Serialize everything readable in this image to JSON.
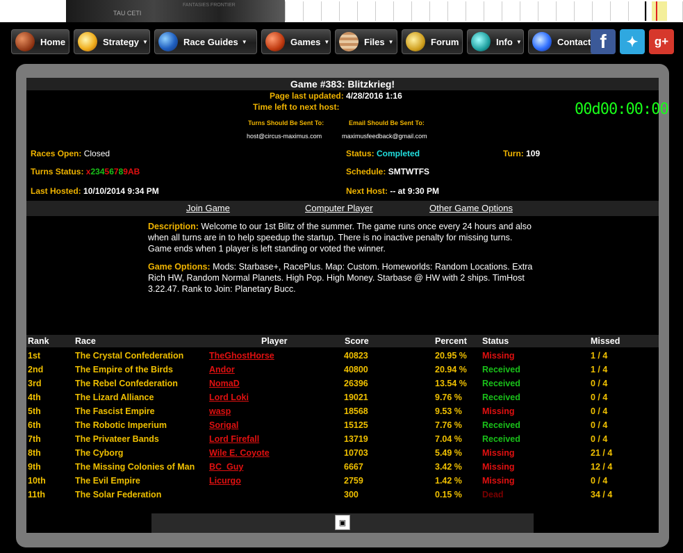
{
  "banner": {
    "site_name": "TAU CETI",
    "tagline": "FANTASIES FRONTIER"
  },
  "nav": {
    "items": [
      {
        "label": "Home",
        "icon": "mars-planet-icon",
        "has_dropdown": false
      },
      {
        "label": "Strategy",
        "icon": "sun-planet-icon",
        "has_dropdown": true
      },
      {
        "label": "Race Guides",
        "icon": "earth-planet-icon",
        "has_dropdown": true
      },
      {
        "label": "Games",
        "icon": "red-planet-icon",
        "has_dropdown": true
      },
      {
        "label": "Files",
        "icon": "jupiter-planet-icon",
        "has_dropdown": true
      },
      {
        "label": "Forum",
        "icon": "saturn-planet-icon",
        "has_dropdown": false
      },
      {
        "label": "Info",
        "icon": "uranus-planet-icon",
        "has_dropdown": true
      },
      {
        "label": "Contact",
        "icon": "blue-planet-icon",
        "has_dropdown": false
      }
    ],
    "social": [
      "facebook-icon",
      "twitter-icon",
      "google-plus-icon"
    ]
  },
  "game": {
    "title": "Game #383: Blitzkrieg!",
    "last_updated_label": "Page last updated:",
    "last_updated_value": "4/28/2016 1:16",
    "time_left_label": "Time left to next host:",
    "countdown": "00d00:00:00",
    "turns_to_label": "Turns Should Be Sent To:",
    "turns_to_value": "host@circus-maximus.com",
    "email_to_label": "Email Should Be Sent To:",
    "email_to_value": "maximusfeedback@gmail.com",
    "races_open_label": "Races Open:",
    "races_open_value": "Closed",
    "status_label": "Status:",
    "status_value": "Completed",
    "turn_label": "Turn:",
    "turn_value": "109",
    "turns_status_label": "Turns Status:",
    "turns_status_chars": [
      {
        "c": "x",
        "color": "#e01010"
      },
      {
        "c": "2",
        "color": "#19c019"
      },
      {
        "c": "3",
        "color": "#19c019"
      },
      {
        "c": "4",
        "color": "#19c019"
      },
      {
        "c": "5",
        "color": "#e01010"
      },
      {
        "c": "6",
        "color": "#19c019"
      },
      {
        "c": "7",
        "color": "#e01010"
      },
      {
        "c": "8",
        "color": "#19c019"
      },
      {
        "c": "9",
        "color": "#e01010"
      },
      {
        "c": "A",
        "color": "#e01010"
      },
      {
        "c": "B",
        "color": "#e01010"
      }
    ],
    "schedule_label": "Schedule:",
    "schedule_value": "SMTWTFS",
    "last_hosted_label": "Last Hosted:",
    "last_hosted_value": "10/10/2014 9:34 PM",
    "next_host_label": "Next Host:",
    "next_host_value": "-- at 9:30 PM"
  },
  "links": {
    "join": "Join Game",
    "computer": "Computer Player",
    "other": "Other Game Options"
  },
  "description": {
    "label": "Description:",
    "text": "Welcome to our 1st Blitz of the summer. The game runs once every 24 hours and also when all turns are in to help speedup the startup. There is no inactive penalty for missing turns. Game ends when 1 player is left standing or voted the winner.",
    "options_label": "Game Options:",
    "options_text": "Mods: Starbase+, RacePlus. Map: Custom. Homeworlds: Random Locations. Extra Rich HW, Random Normal Planets. High Pop. High Money. Starbase @ HW with 2 ships. TimHost 3.22.47. Rank to Join: Planetary Bucc."
  },
  "table": {
    "headers": {
      "rank": "Rank",
      "race": "Race",
      "player": "Player",
      "score": "Score",
      "percent": "Percent",
      "status": "Status",
      "missed": "Missed"
    },
    "rows": [
      {
        "rank": "1st",
        "race": "The Crystal Confederation",
        "player": "TheGhostHorse",
        "score": "40823",
        "percent": "20.95 %",
        "status": "Missing",
        "missed": "1 / 4"
      },
      {
        "rank": "2nd",
        "race": "The Empire of the Birds",
        "player": "Andor",
        "score": "40800",
        "percent": "20.94 %",
        "status": "Received",
        "missed": "1 / 4"
      },
      {
        "rank": "3rd",
        "race": "The Rebel Confederation",
        "player": "NomaD",
        "score": "26396",
        "percent": "13.54 %",
        "status": "Received",
        "missed": "0 / 4"
      },
      {
        "rank": "4th",
        "race": "The Lizard Alliance",
        "player": "Lord Loki",
        "score": "19021",
        "percent": "9.76 %",
        "status": "Received",
        "missed": "0 / 4"
      },
      {
        "rank": "5th",
        "race": "The Fascist Empire",
        "player": "wasp",
        "score": "18568",
        "percent": "9.53 %",
        "status": "Missing",
        "missed": "0 / 4"
      },
      {
        "rank": "6th",
        "race": "The Robotic Imperium",
        "player": "Sorigal",
        "score": "15125",
        "percent": "7.76 %",
        "status": "Received",
        "missed": "0 / 4"
      },
      {
        "rank": "7th",
        "race": "The Privateer Bands",
        "player": "Lord Firefall",
        "score": "13719",
        "percent": "7.04 %",
        "status": "Received",
        "missed": "0 / 4"
      },
      {
        "rank": "8th",
        "race": "The Cyborg",
        "player": "Wile E. Coyote",
        "score": "10703",
        "percent": "5.49 %",
        "status": "Missing",
        "missed": "21 / 4"
      },
      {
        "rank": "9th",
        "race": "The Missing Colonies of Man",
        "player": "BC_Guy",
        "score": "6667",
        "percent": "3.42 %",
        "status": "Missing",
        "missed": "12 / 4"
      },
      {
        "rank": "10th",
        "race": "The Evil Empire",
        "player": "Licurgo",
        "score": "2759",
        "percent": "1.42 %",
        "status": "Missing",
        "missed": "0 / 4"
      },
      {
        "rank": "11th",
        "race": "The Solar Federation",
        "player": "",
        "score": "300",
        "percent": "0.15 %",
        "status": "Dead",
        "missed": "34 / 4"
      }
    ]
  },
  "status_colors": {
    "Missing": "#e01010",
    "Received": "#19c019",
    "Dead": "#7a0000"
  },
  "footer_icon": "image-icon"
}
